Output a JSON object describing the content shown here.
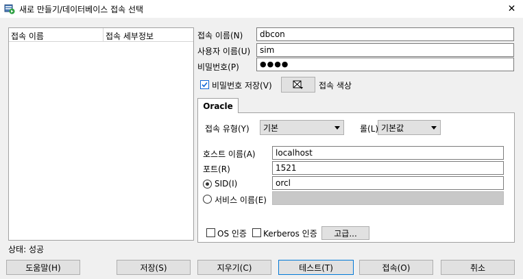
{
  "window": {
    "title": "새로 만들기/데이터베이스 접속 선택",
    "close_glyph": "✕"
  },
  "conn_list": {
    "columns": [
      "접속 이름",
      "접속 세부정보"
    ]
  },
  "fields": {
    "conn_name_label": "접속 이름(N)",
    "conn_name_value": "dbcon",
    "user_label": "사용자 이름(U)",
    "user_value": "sim",
    "password_label": "비밀번호(P)",
    "password_value": "●●●●",
    "save_password_label": "비밀번호 저장(V)",
    "save_password_checked": true,
    "conn_color_label": "접속 색상"
  },
  "oracle": {
    "tab_label": "Oracle",
    "conn_type_label": "접속 유형(Y)",
    "conn_type_value": "기본",
    "role_label": "롤(L)",
    "role_value": "기본값",
    "host_label": "호스트 이름(A)",
    "host_value": "localhost",
    "port_label": "포트(R)",
    "port_value": "1521",
    "sid_label": "SID(I)",
    "sid_value": "orcl",
    "service_label": "서비스 이름(E)",
    "service_value": "",
    "os_auth_label": "OS 인증",
    "kerberos_label": "Kerberos 인증",
    "advanced_label": "고급..."
  },
  "status": {
    "text": "상태: 성공"
  },
  "buttons": {
    "help": "도움말(H)",
    "save": "저장(S)",
    "clear": "지우기(C)",
    "test": "테스트(T)",
    "connect": "접속(O)",
    "cancel": "취소"
  }
}
